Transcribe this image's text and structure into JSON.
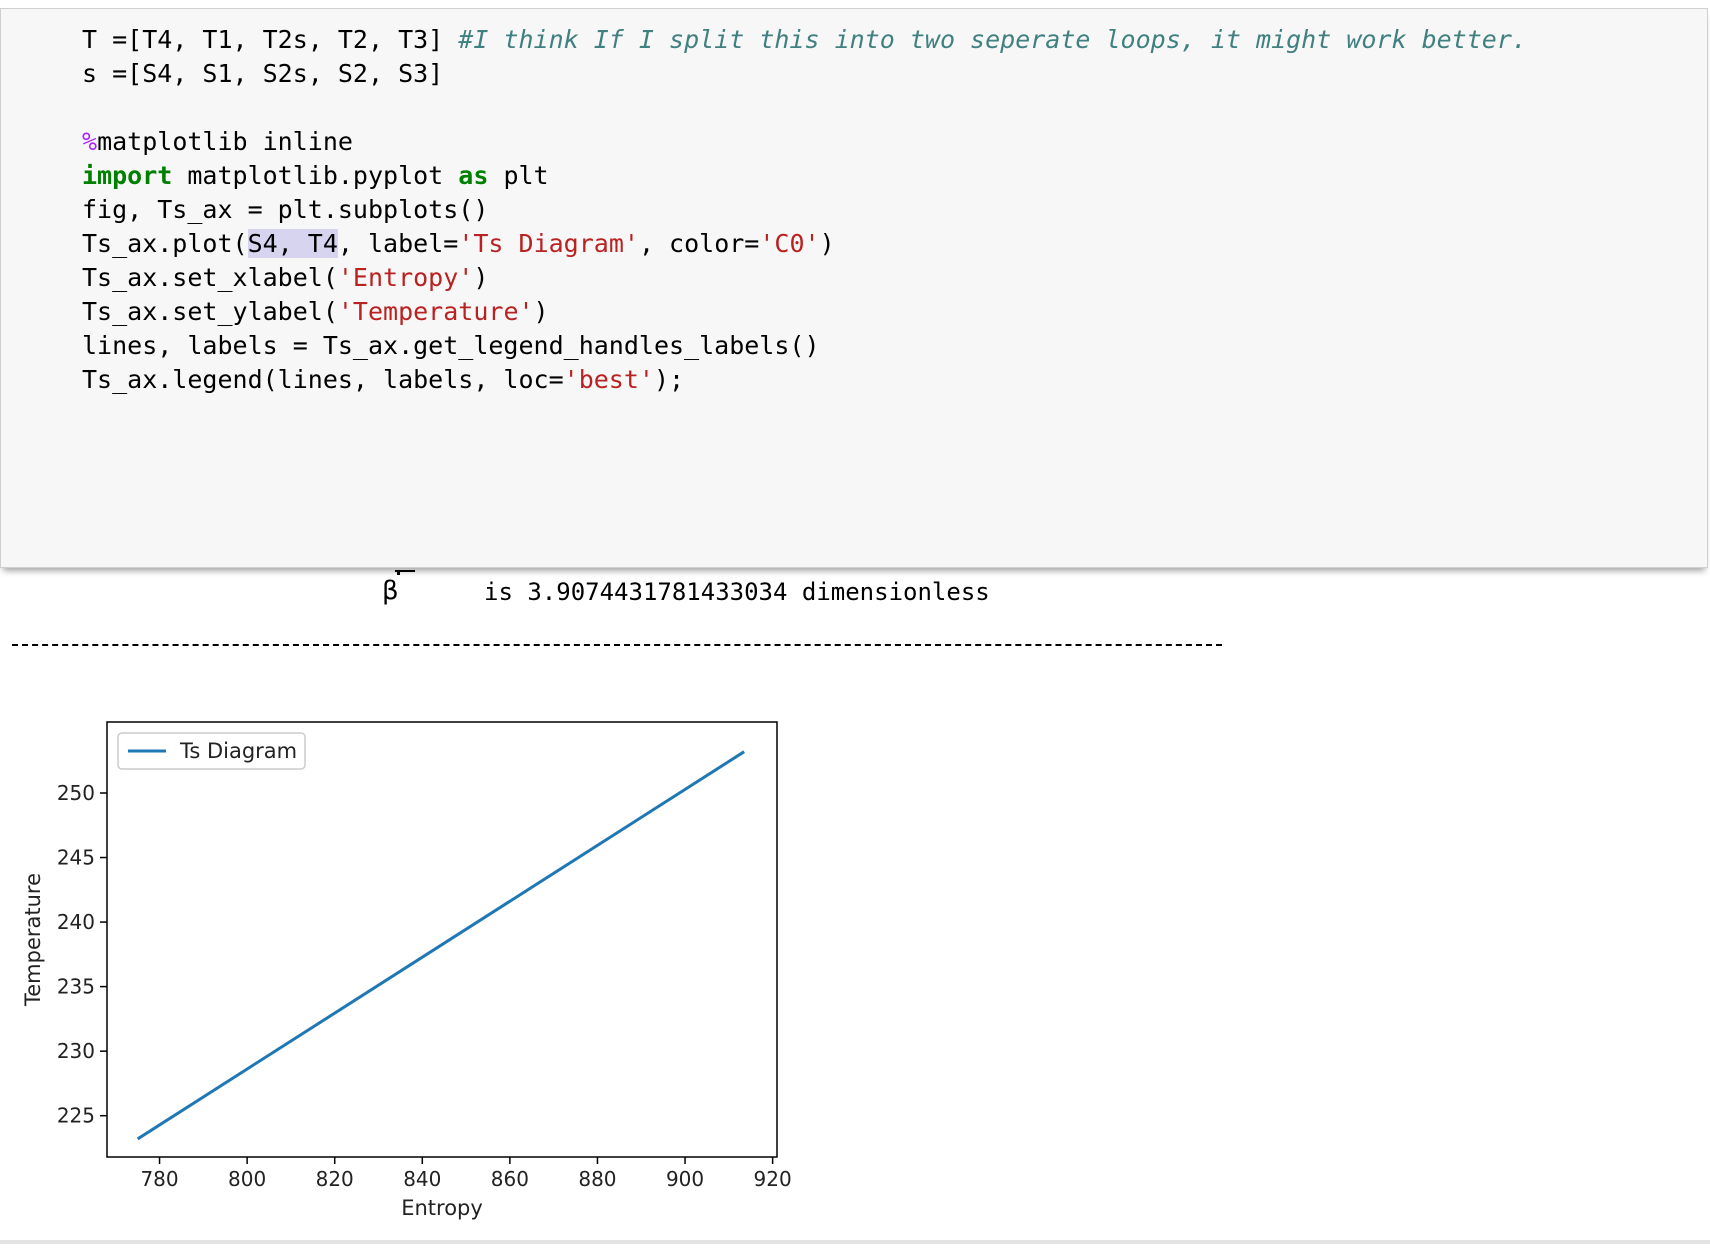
{
  "code_cell": {
    "line1": {
      "code": "T =[T4, T1, T2s, T2, T3] ",
      "comment": "#I think If I split this into two seperate loops, it might work better."
    },
    "line2": "s =[S4, S1, S2s, S2, S3]",
    "line4": {
      "magic": "%",
      "rest": "matplotlib inline"
    },
    "line5": {
      "kw1": "import",
      "mid": " matplotlib.pyplot ",
      "kw2": "as",
      "end": " plt"
    },
    "line6": "fig, Ts_ax = plt.subplots()",
    "line7": {
      "a": "Ts_ax.plot(",
      "hl": "S4, T4",
      "b": ", label=",
      "s1": "'Ts Diagram'",
      "c": ", color=",
      "s2": "'C0'",
      "d": ")"
    },
    "line8": {
      "a": "Ts_ax.set_xlabel(",
      "s": "'Entropy'",
      "b": ")"
    },
    "line9": {
      "a": "Ts_ax.set_ylabel(",
      "s": "'Temperature'",
      "b": ")"
    },
    "line10": "lines, labels = Ts_ax.get_legend_handles_labels()",
    "line11": {
      "a": "Ts_ax.legend(lines, labels, loc=",
      "s": "'best'",
      "b": ");"
    }
  },
  "output": {
    "beta_symbol": "β",
    "result_text": "is 3.9074431781433034 dimensionless"
  },
  "chart_data": {
    "type": "line",
    "xlabel": "Entropy",
    "ylabel": "Temperature",
    "xlim": [
      768,
      921
    ],
    "ylim": [
      221.8,
      255.5
    ],
    "xticks": [
      780,
      800,
      820,
      840,
      860,
      880,
      900,
      920
    ],
    "yticks": [
      225,
      230,
      235,
      240,
      245,
      250
    ],
    "legend_location": "top-left",
    "series": [
      {
        "name": "Ts Diagram",
        "color": "#1f77b4",
        "x": [
          775,
          913.5
        ],
        "y": [
          223.2,
          253.2
        ]
      }
    ]
  }
}
